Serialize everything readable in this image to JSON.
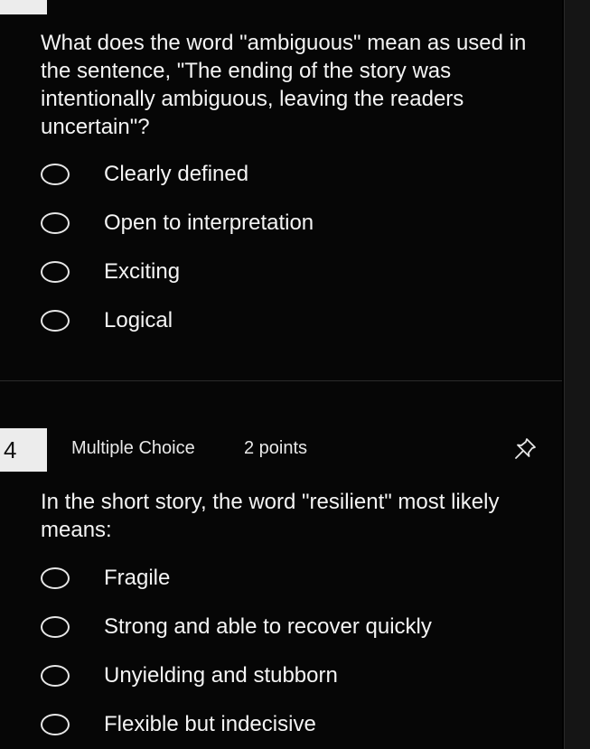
{
  "previous_question": {
    "text": "What does the word \"ambiguous\" mean as used in the sentence, \"The ending of the story was intentionally ambiguous, leaving the readers uncertain\"?",
    "options": [
      "Clearly defined",
      "Open to interpretation",
      "Exciting",
      "Logical"
    ]
  },
  "question_4": {
    "number": "4",
    "type": "Multiple Choice",
    "points": "2 points",
    "text": "In the short story, the word \"resilient\" most likely means:",
    "options": [
      "Fragile",
      "Strong and able to recover quickly",
      "Unyielding and stubborn",
      "Flexible but indecisive"
    ]
  },
  "icons": {
    "pin": "pushpin-icon",
    "radio": "radio-circle-icon"
  },
  "colors": {
    "background": "#060606",
    "text": "#f4f4f4",
    "number_box": "#ececec"
  }
}
